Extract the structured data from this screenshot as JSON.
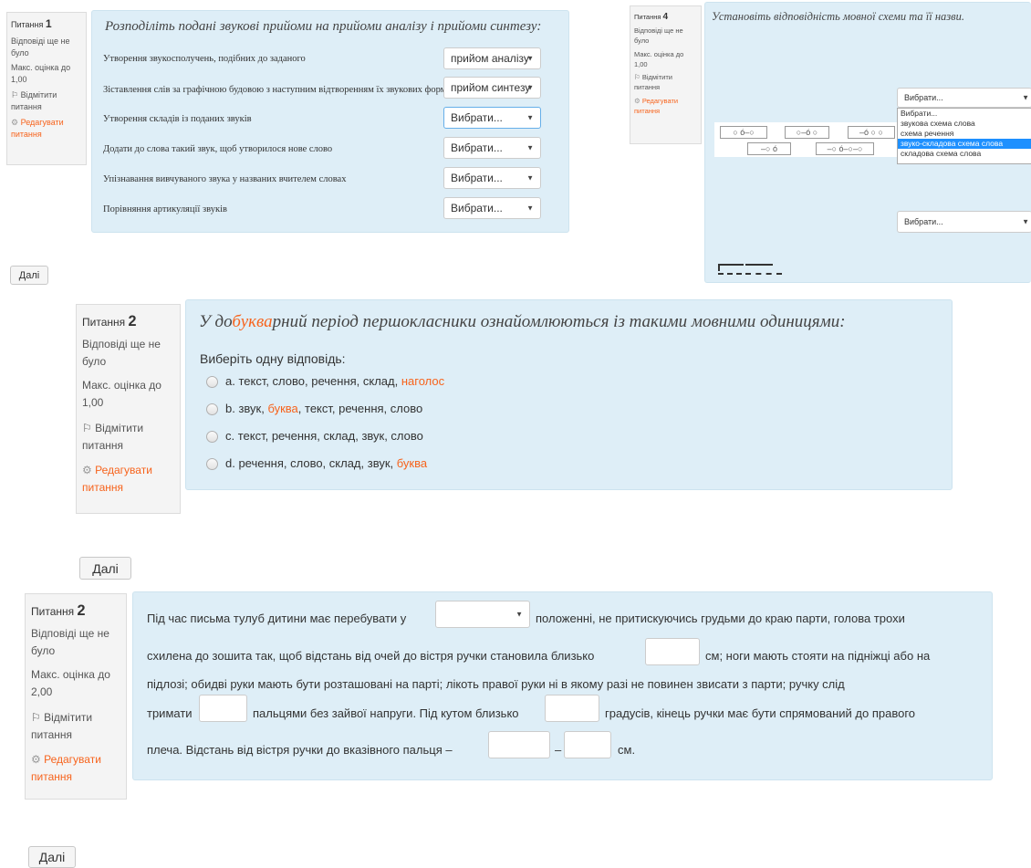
{
  "q1": {
    "number_label": "Питання",
    "number": "1",
    "status": "Відповіді ще не було",
    "max_grade": "Макс. оцінка до 1,00",
    "flag_label": "Відмітити питання",
    "edit_label": "Редагувати питання",
    "prompt": "Розподіліть подані звукові прийоми на прийоми аналізу і прийоми синтезу:",
    "rows": [
      {
        "text": "Утворення звукосполучень, подібних до заданого",
        "select": "прийом аналізу"
      },
      {
        "text": "Зіставлення слів за графічною будовою з наступним відтворенням їх звукових форм",
        "select": "прийом синтезу"
      },
      {
        "text": "Утворення складів із поданих звуків",
        "select": "Вибрати..."
      },
      {
        "text": "Додати до слова такий звук, щоб утворилося нове слово",
        "select": "Вибрати..."
      },
      {
        "text": "Упізнавання вивчуваного звука у названих вчителем словах",
        "select": "Вибрати..."
      },
      {
        "text": "Порівняння артикуляції звуків",
        "select": "Вибрати..."
      }
    ],
    "next_label": "Далі"
  },
  "q4": {
    "number_label": "Питання",
    "number": "4",
    "status": "Відповіді ще не було",
    "max_grade": "Макс. оцінка до 1,00",
    "flag_label": "Відмітити питання",
    "edit_label": "Редагувати питання",
    "prompt": "Установіть відповідність мовної схеми та її назви.",
    "select1": "Вибрати...",
    "dropdown_options": [
      "Вибрати...",
      "звукова схема слова",
      "схема речення",
      "звуко-складова схема слова",
      "складова схема слова"
    ],
    "dropdown_selected_index": 3,
    "select2": "Вибрати...",
    "schemes_row1": [
      "○ ó–○",
      "○–ó ○",
      "–ó ○ ○"
    ],
    "schemes_row2": [
      "–○ ó",
      "–○ ó–○–○"
    ]
  },
  "q2a": {
    "number_label": "Питання",
    "number": "2",
    "status": "Відповіді ще не було",
    "max_grade": "Макс. оцінка до 1,00",
    "flag_label": "Відмітити питання",
    "edit_label": "Редагувати питання",
    "prompt_pre": "У до",
    "prompt_hl": "буква",
    "prompt_post": "рний період першокласники ознайомлюються із такими мовними одиницями:",
    "instruction": "Виберіть одну відповідь:",
    "options": [
      {
        "main": "a. текст, слово, речення, склад, ",
        "hl": "наголос",
        "tail": ""
      },
      {
        "main": "b. звук, ",
        "hl": "буква",
        "tail": ", текст, речення, слово"
      },
      {
        "main": "c. текст, речення, склад, звук, слово",
        "hl": "",
        "tail": ""
      },
      {
        "main": "d. речення, слово, склад, звук, ",
        "hl": "буква",
        "tail": ""
      }
    ],
    "next_label": "Далі"
  },
  "q2b": {
    "number_label": "Питання",
    "number": "2",
    "status": "Відповіді ще не було",
    "max_grade": "Макс. оцінка до 2,00",
    "flag_label": "Відмітити питання",
    "edit_label": "Редагувати питання",
    "t1": "Під час письма тулуб дитини має перебувати у",
    "t2": "положенні, не притискуючись грудьми до краю парти, голова трохи",
    "t3": "схилена до зошита так, щоб відстань  від очей до вістря ручки становила близько",
    "t4": "см; ноги мають стояти на підніжці або на",
    "t5": "підлозі; обидві руки мають бути розташовані на парті; лікоть правої руки ні в якому разі не повинен звисати з парти; ручку слід",
    "t6": "тримати",
    "t7": "пальцями без зайвої напруги. Під кутом близько",
    "t8": "градусів, кінець ручки має бути спрямований до правого",
    "t9": "плеча. Відстань від вістря ручки до вказівного пальця –",
    "t10": "–",
    "t11": "см.",
    "next_label": "Далі"
  }
}
